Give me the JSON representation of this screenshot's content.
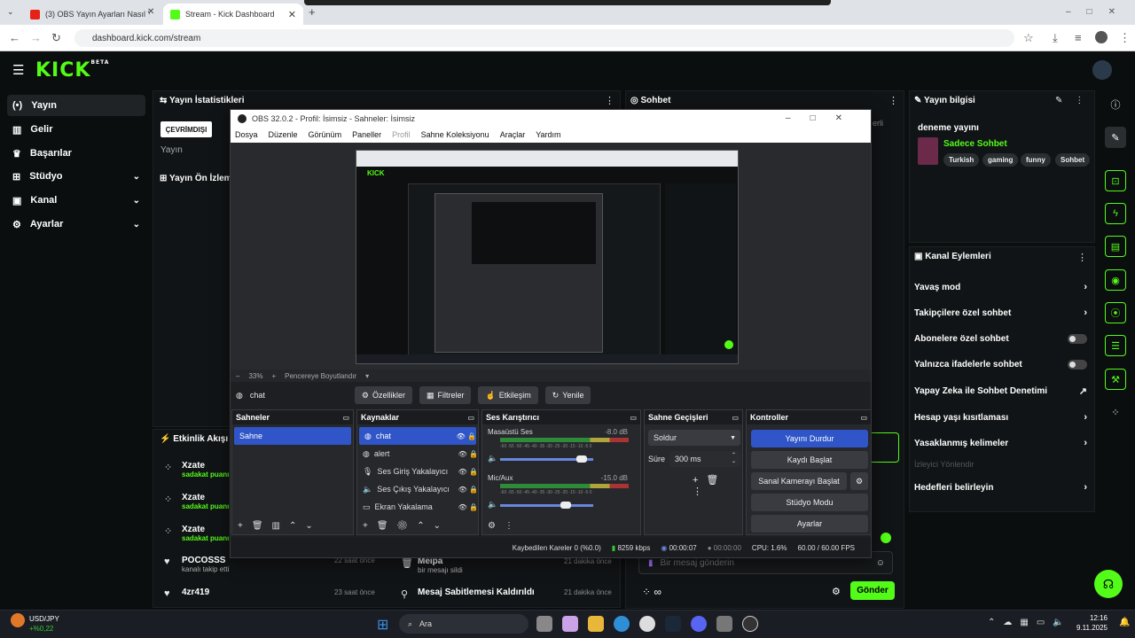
{
  "browser": {
    "tabs": [
      {
        "label": "(3) OBS Yayın Ayarları Nasıl Yap",
        "close": "✕"
      },
      {
        "label": "Stream - Kick Dashboard",
        "close": "✕"
      }
    ],
    "new_tab": "+",
    "url": "dashboard.kick.com/stream"
  },
  "kick": {
    "logo": "KICK",
    "logo_beta": "BETA",
    "sidebar": [
      {
        "label": "Yayın",
        "icon": "broadcast-icon"
      },
      {
        "label": "Gelir",
        "icon": "revenue-icon"
      },
      {
        "label": "Başarılar",
        "icon": "trophy-icon"
      },
      {
        "label": "Stüdyo",
        "icon": "studio-icon"
      },
      {
        "label": "Kanal",
        "icon": "channel-icon"
      },
      {
        "label": "Ayarlar",
        "icon": "gear-icon"
      }
    ],
    "stats_title": "Yayın İstatistikleri",
    "offline_badge": "ÇEVRİMDIŞI",
    "stream_label": "Yayın",
    "preview_title": "Yayın Ön İzleme",
    "chat_title": "Sohbet",
    "chat_partial": "erli",
    "activity_title": "Etkinlik Akışı",
    "activity": [
      {
        "name": "Xzate",
        "sub": "sadakat puanı",
        "time": ""
      },
      {
        "name": "Xzate",
        "sub": "sadakat puanı",
        "time": ""
      },
      {
        "name": "Xzate",
        "sub": "sadakat puanı",
        "time": ""
      },
      {
        "name": "POCOSSS",
        "sub": "kanalı takip etti",
        "time": "22 saat önce"
      },
      {
        "name": "4zr419",
        "sub": "",
        "time": "23 saat önce"
      }
    ],
    "mod_feed": [
      {
        "name": "Meipa",
        "sub": "bir mesajı sildi",
        "time": "21 dakika önce"
      },
      {
        "name": "Mesaj Sabitlemesi Kaldırıldı",
        "sub": "",
        "time": "21 dakika önce"
      }
    ],
    "chat_placeholder": "Bir mesaj gönderin",
    "send_label": "Gönder",
    "info_title": "Yayın bilgisi",
    "stream_name": "deneme yayını",
    "category": "Sadece Sohbet",
    "tags": [
      "Turkish",
      "gaming",
      "funny",
      "Sohbet"
    ],
    "actions_title": "Kanal Eylemleri",
    "actions": [
      {
        "label": "Yavaş mod",
        "type": "arrow"
      },
      {
        "label": "Takipçilere özel sohbet",
        "type": "arrow"
      },
      {
        "label": "Abonelere özel sohbet",
        "type": "toggle"
      },
      {
        "label": "Yalnızca ifadelerle sohbet",
        "type": "toggle"
      },
      {
        "label": "Yapay Zeka ile Sohbet Denetimi",
        "type": "external"
      },
      {
        "label": "Hesap yaşı kısıtlaması",
        "type": "arrow"
      },
      {
        "label": "Yasaklanmış kelimeler",
        "type": "arrow"
      },
      {
        "label": "İzleyici Yönlendir",
        "type": "disabled"
      },
      {
        "label": "Hedefleri belirleyin",
        "type": "arrow"
      }
    ]
  },
  "obs": {
    "title": "OBS 32.0.2 - Profil: İsimsiz - Sahneler: İsimsiz",
    "menu": [
      "Dosya",
      "Düzenle",
      "Görünüm",
      "Paneller",
      "Profil",
      "Sahne Koleksiyonu",
      "Araçlar",
      "Yardım"
    ],
    "zoom": "33%",
    "fit_label": "Pencereye Boyutlandır",
    "current_source": "chat",
    "src_buttons": [
      "Özellikler",
      "Filtreler",
      "Etkileşim",
      "Yenile"
    ],
    "scenes_title": "Sahneler",
    "scenes": [
      "Sahne"
    ],
    "sources_title": "Kaynaklar",
    "sources": [
      {
        "label": "chat",
        "icon": "browser-icon"
      },
      {
        "label": "alert",
        "icon": "browser-icon"
      },
      {
        "label": "Ses Giriş Yakalayıcı",
        "icon": "mic-icon"
      },
      {
        "label": "Ses Çıkış Yakalayıcı",
        "icon": "speaker-icon"
      },
      {
        "label": "Ekran Yakalama",
        "icon": "monitor-icon"
      }
    ],
    "mixer_title": "Ses Karıştırıcı",
    "mixer": [
      {
        "name": "Masaüstü Ses",
        "db": "-8.0 dB",
        "level": 0.72
      },
      {
        "name": "Mic/Aux",
        "db": "-15.0 dB",
        "level": 0.62
      }
    ],
    "mixer_scale": "-60 -55 -50 -45 -40 -35 -30 -25 -20 -15 -10 -5 0",
    "trans_title": "Sahne Geçişleri",
    "transition": "Soldur",
    "duration_label": "Süre",
    "duration": "300 ms",
    "controls_title": "Kontroller",
    "controls": [
      "Yayını Durdur",
      "Kaydı Başlat",
      "Sanal Kamerayı Başlat",
      "Stüdyo Modu",
      "Ayarlar"
    ],
    "status": {
      "dropped": "Kaybedilen Kareler 0 (%0.0)",
      "bitrate": "8259 kbps",
      "stream_time": "00:00:07",
      "rec_time": "00:00:00",
      "cpu": "CPU: 1.6%",
      "fps": "60.00 / 60.00 FPS"
    }
  },
  "taskbar": {
    "ticker": "USD/JPY",
    "ticker_change": "+%0,22",
    "search": "Ara",
    "time": "12:16",
    "date": "9.11.2025"
  }
}
